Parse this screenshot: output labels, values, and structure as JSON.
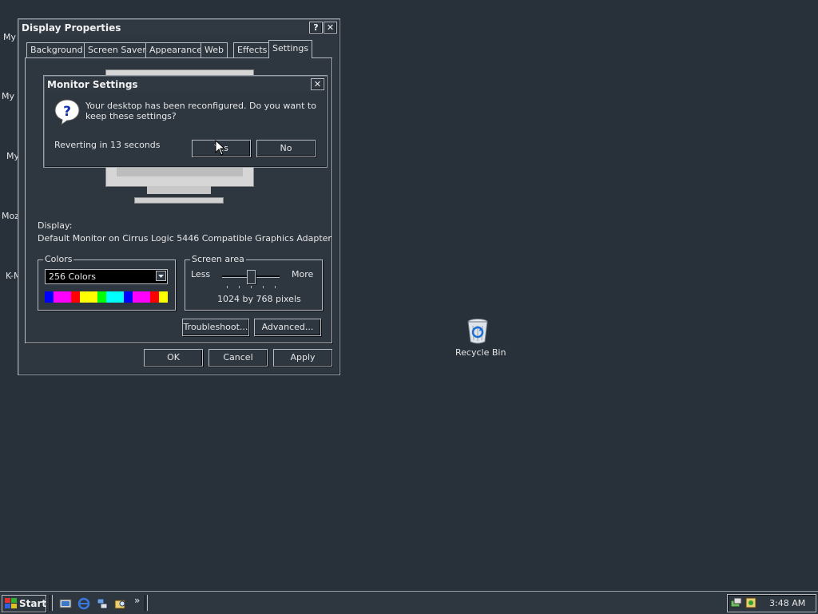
{
  "desktop": {
    "partial_labels": [
      "My",
      "My D",
      "My",
      "Moz",
      "K-M"
    ],
    "recycle_bin_label": "Recycle Bin"
  },
  "display_properties": {
    "title": "Display Properties",
    "tabs": [
      "Background",
      "Screen Saver",
      "Appearance",
      "Web",
      "Effects",
      "Settings"
    ],
    "display_label": "Display:",
    "display_value": "Default Monitor on Cirrus Logic 5446 Compatible Graphics Adapter",
    "colors_group": "Colors",
    "colors_selected": "256 Colors",
    "palette": [
      "#0000ff",
      "#ff00ff",
      "#ff00ff",
      "#ff0000",
      "#ffff00",
      "#ffff00",
      "#00ff00",
      "#00ffff",
      "#00ffff",
      "#0000ff",
      "#ff00ff",
      "#ff00ff",
      "#ff0000",
      "#ffff00"
    ],
    "screen_area_group": "Screen area",
    "less_label": "Less",
    "more_label": "More",
    "resolution": "1024 by 768 pixels",
    "troubleshoot_label": "Troubleshoot...",
    "advanced_label": "Advanced...",
    "ok_label": "OK",
    "cancel_label": "Cancel",
    "apply_label": "Apply"
  },
  "monitor_settings": {
    "title": "Monitor Settings",
    "message": "Your desktop has been reconfigured.  Do you want to keep these settings?",
    "countdown": "Reverting in 13 seconds",
    "yes_label": "Yes",
    "no_label": "No"
  },
  "taskbar": {
    "start_label": "Start",
    "chevron": "»",
    "clock": "3:48 AM"
  },
  "colors": {
    "desktop_bg": "#28303a",
    "window_bg": "#2e3640"
  }
}
